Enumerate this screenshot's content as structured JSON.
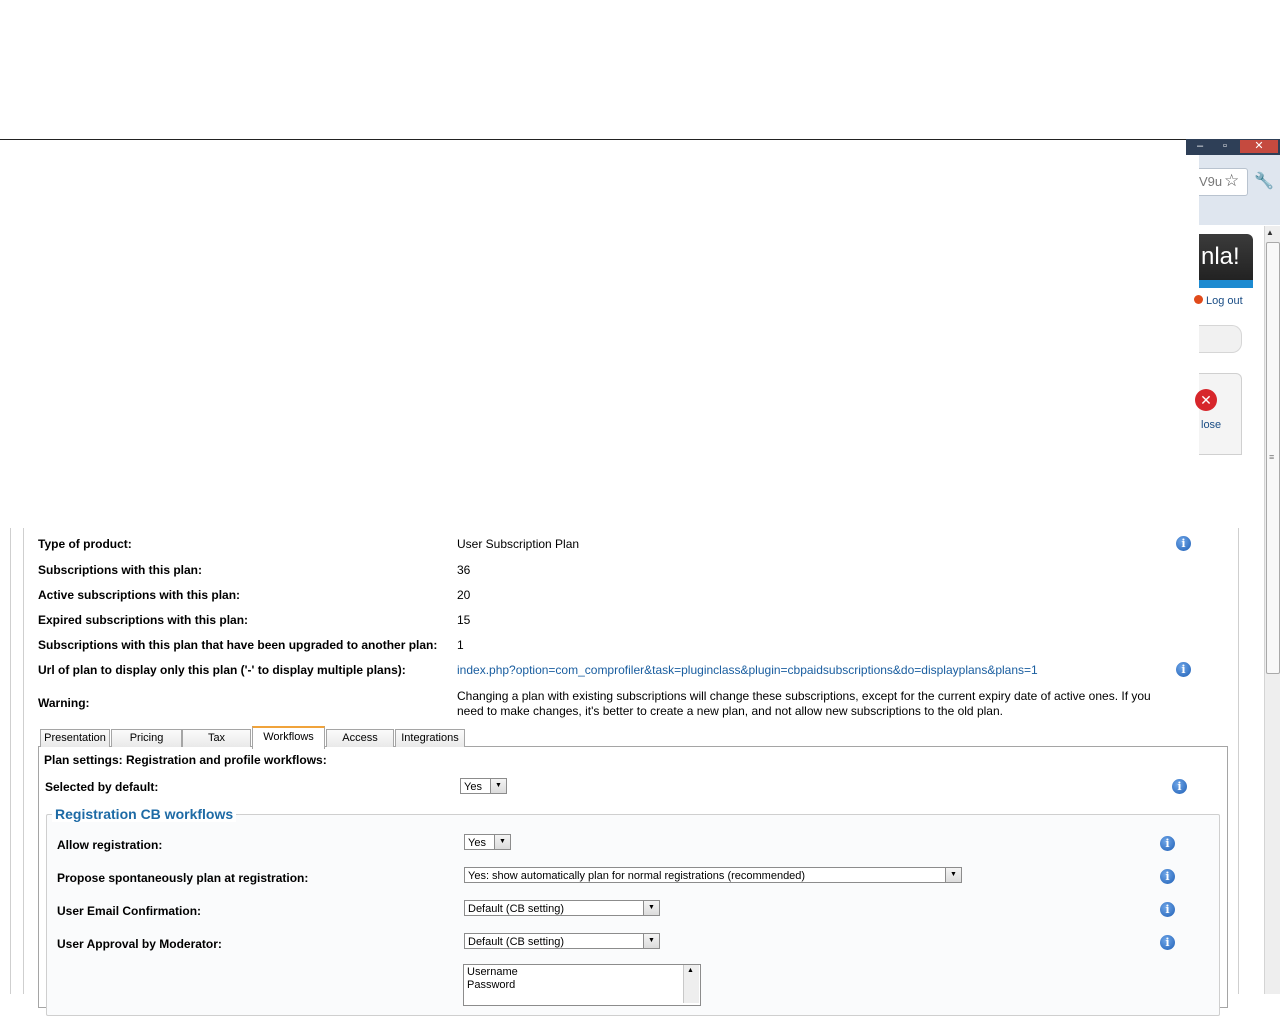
{
  "browser": {
    "address_tail": "V9u",
    "star_icon": "star-icon",
    "wrench_icon": "wrench-icon"
  },
  "admin": {
    "logo_fragment": "nla!",
    "logout": "Log out",
    "close_label": "lose"
  },
  "info_rows": [
    {
      "label": "Type of product:",
      "value": "User Subscription Plan"
    },
    {
      "label": "Subscriptions with this plan:",
      "value": "36"
    },
    {
      "label": "Active subscriptions with this plan:",
      "value": "20"
    },
    {
      "label": "Expired subscriptions with this plan:",
      "value": "15"
    },
    {
      "label": "Subscriptions with this plan that have been upgraded to another plan:",
      "value": "1"
    },
    {
      "label": "Url of plan to display only this plan ('-' to display multiple plans):",
      "value": "index.php?option=com_comprofiler&task=pluginclass&plugin=cbpaidsubscriptions&do=displayplans&plans=1"
    },
    {
      "label": "Warning:",
      "value": "Changing a plan with existing subscriptions will change these subscriptions, except for the current expiry date of active ones. If you need to make changes, it's better to create a new plan, and not allow new subscriptions to the old plan."
    }
  ],
  "tabs": [
    "Presentation",
    "Pricing",
    "Tax",
    "Workflows",
    "Access",
    "Integrations"
  ],
  "panel": {
    "heading": "Plan settings: Registration and profile workflows:",
    "selected_default_label": "Selected by default:",
    "selected_default_value": "Yes",
    "legend": "Registration CB workflows",
    "fields": [
      {
        "label": "Allow registration:",
        "value": "Yes"
      },
      {
        "label": "Propose spontaneously plan at registration:",
        "value": "Yes: show automatically plan for normal registrations (recommended)"
      },
      {
        "label": "User Email Confirmation:",
        "value": "Default (CB setting)"
      },
      {
        "label": "User Approval by Moderator:",
        "value": "Default (CB setting)"
      }
    ],
    "list_items": [
      "Username",
      "Password"
    ]
  }
}
